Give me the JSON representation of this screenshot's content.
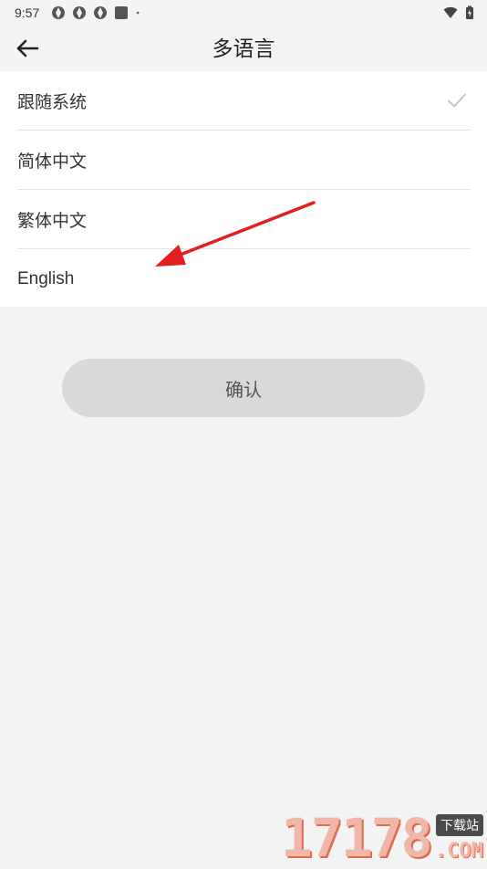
{
  "status_bar": {
    "time": "9:57",
    "left_icons": [
      "app-notification-icon",
      "app-notification-icon",
      "app-notification-icon",
      "square-notification-icon",
      "dot-icon"
    ],
    "right_icons": [
      "wifi-icon",
      "battery-charging-icon"
    ]
  },
  "header": {
    "back_icon": "arrow-left-icon",
    "title": "多语言"
  },
  "languages": [
    {
      "label": "跟随系统",
      "selected": true
    },
    {
      "label": "简体中文",
      "selected": false
    },
    {
      "label": "繁体中文",
      "selected": false
    },
    {
      "label": "English",
      "selected": false
    }
  ],
  "confirm_button": {
    "label": "确认"
  },
  "annotation": {
    "color": "#e02020",
    "icon": "red-arrow-pointer"
  },
  "watermark": {
    "digits": "17178",
    "tag": "下载站",
    "suffix": ".COM"
  },
  "colors": {
    "background": "#f3f3f3",
    "list_background": "#ffffff",
    "button_background": "#d9d9d9",
    "check_color": "#c8c8c8"
  }
}
